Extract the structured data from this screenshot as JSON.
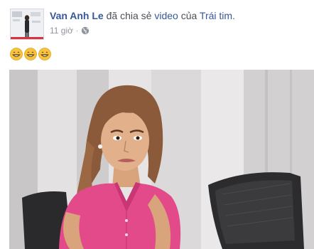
{
  "post": {
    "author_name": "Van Anh Le",
    "action_text": "đã chia sẻ",
    "object_text": "video",
    "connector_text": "của",
    "page_name": "Trái tim.",
    "timestamp": "11 giờ",
    "separator": "·",
    "privacy_icon": "globe-icon",
    "content_emojis": [
      "grinning-face",
      "grinning-face",
      "grinning-face"
    ]
  },
  "colors": {
    "link_blue": "#365899",
    "meta_gray": "#90949c",
    "shirt_pink": "#e34a8a",
    "emoji_yellow": "#f7c23c"
  }
}
